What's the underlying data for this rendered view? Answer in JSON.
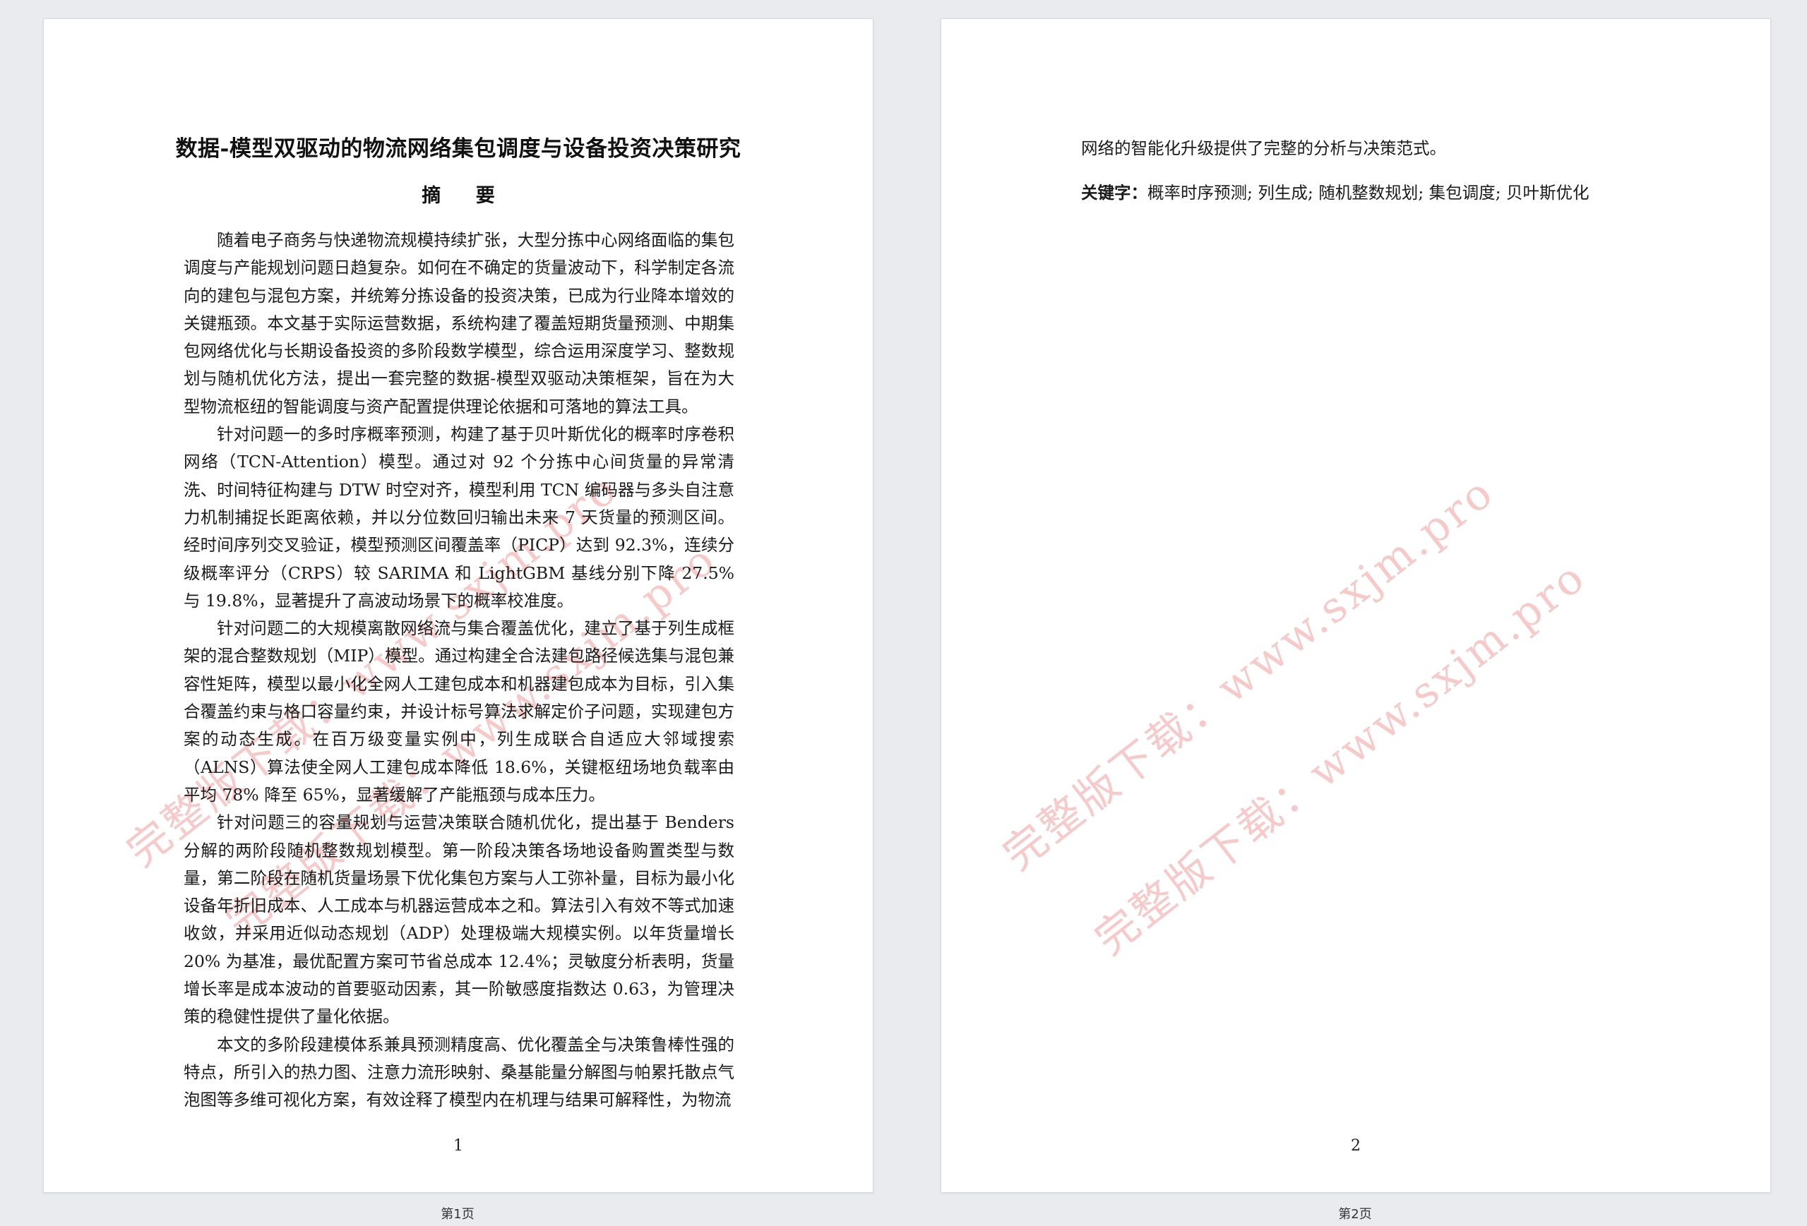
{
  "pages": [
    {
      "title": "数据-模型双驱动的物流网络集包调度与设备投资决策研究",
      "abstract_heading": "摘 要",
      "paragraphs": [
        "随着电子商务与快递物流规模持续扩张，大型分拣中心网络面临的集包调度与产能规划问题日趋复杂。如何在不确定的货量波动下，科学制定各流向的建包与混包方案，并统筹分拣设备的投资决策，已成为行业降本增效的关键瓶颈。本文基于实际运营数据，系统构建了覆盖短期货量预测、中期集包网络优化与长期设备投资的多阶段数学模型，综合运用深度学习、整数规划与随机优化方法，提出一套完整的数据-模型双驱动决策框架，旨在为大型物流枢纽的智能调度与资产配置提供理论依据和可落地的算法工具。",
        "针对问题一的多时序概率预测，构建了基于贝叶斯优化的概率时序卷积网络（TCN-Attention）模型。通过对 92 个分拣中心间货量的异常清洗、时间特征构建与 DTW 时空对齐，模型利用 TCN 编码器与多头自注意力机制捕捉长距离依赖，并以分位数回归输出未来 7 天货量的预测区间。经时间序列交叉验证，模型预测区间覆盖率（PICP）达到 92.3%，连续分级概率评分（CRPS）较 SARIMA 和 LightGBM 基线分别下降 27.5% 与 19.8%，显著提升了高波动场景下的概率校准度。",
        "针对问题二的大规模离散网络流与集合覆盖优化，建立了基于列生成框架的混合整数规划（MIP）模型。通过构建全合法建包路径候选集与混包兼容性矩阵，模型以最小化全网人工建包成本和机器建包成本为目标，引入集合覆盖约束与格口容量约束，并设计标号算法求解定价子问题，实现建包方案的动态生成。在百万级变量实例中，列生成联合自适应大邻域搜索（ALNS）算法使全网人工建包成本降低 18.6%，关键枢纽场地负载率由平均 78% 降至 65%，显著缓解了产能瓶颈与成本压力。",
        "针对问题三的容量规划与运营决策联合随机优化，提出基于 Benders 分解的两阶段随机整数规划模型。第一阶段决策各场地设备购置类型与数量，第二阶段在随机货量场景下优化集包方案与人工弥补量，目标为最小化设备年折旧成本、人工成本与机器运营成本之和。算法引入有效不等式加速收敛，并采用近似动态规划（ADP）处理极端大规模实例。以年货量增长 20% 为基准，最优配置方案可节省总成本 12.4%；灵敏度分析表明，货量增长率是成本波动的首要驱动因素，其一阶敏感度指数达 0.63，为管理决策的稳健性提供了量化依据。",
        "本文的多阶段建模体系兼具预测精度高、优化覆盖全与决策鲁棒性强的特点，所引入的热力图、注意力流形映射、桑基能量分解图与帕累托散点气泡图等多维可视化方案，有效诠释了模型内在机理与结果可解释性，为物流"
      ],
      "page_number": "1",
      "viewer_label": "第1页",
      "watermark_lines": [
        "完整版下载：www.sxjm.pro",
        "完整版下载：www.sxjm.pro"
      ]
    },
    {
      "continuation": "网络的智能化升级提供了完整的分析与决策范式。",
      "keywords_label": "关键字：",
      "keywords": "概率时序预测; 列生成; 随机整数规划; 集包调度; 贝叶斯优化",
      "page_number": "2",
      "viewer_label": "第2页",
      "watermark_lines": [
        "完整版下载：www.sxjm.pro",
        "完整版下载：www.sxjm.pro"
      ]
    }
  ]
}
